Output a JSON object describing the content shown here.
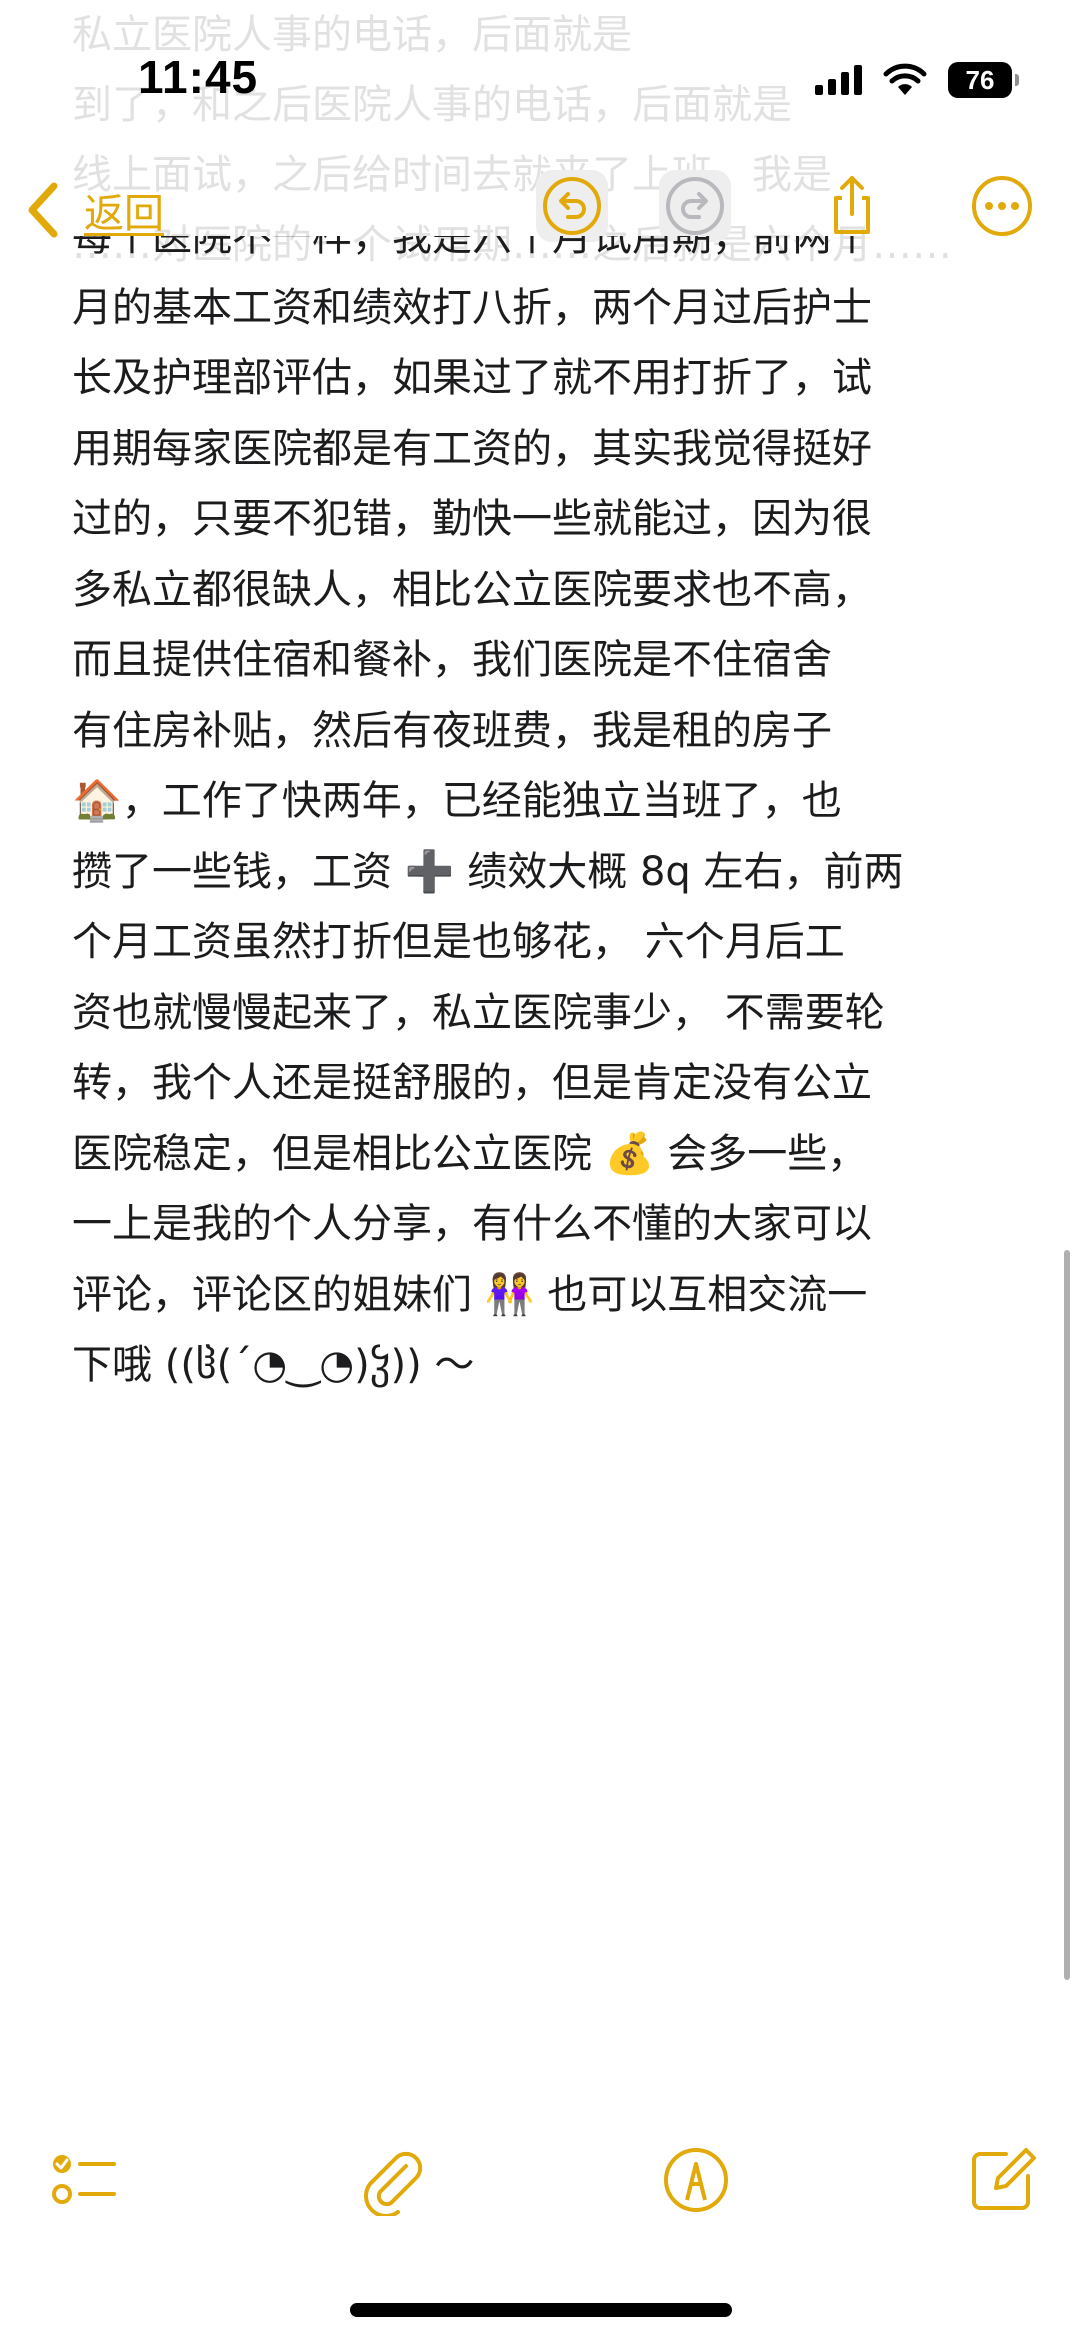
{
  "status_bar": {
    "time": "11:45",
    "battery": "76",
    "icons": [
      "signal-icon",
      "wifi-icon",
      "battery-icon"
    ]
  },
  "ghost_text": {
    "lines": [
      "私立医院人事的电话，后面就是",
      "到了，和之后医院人事的电话，后面就是",
      "线上面试，之后给时间去就来了上班，我是",
      "……对医院的一个试用期……之后就是六个月……"
    ]
  },
  "nav": {
    "back_label": "返回",
    "icons": {
      "back": "chevron-left-icon",
      "undo": "undo-icon",
      "redo": "redo-icon",
      "share": "share-icon",
      "more": "ellipsis-icon"
    },
    "accent_color": "#e2a90b"
  },
  "note": {
    "lines": [
      "每个医院不一样，我是六个月试用期，前两个",
      "月的基本工资和绩效打八折，两个月过后护士",
      "长及护理部评估，如果过了就不用打折了，试",
      "用期每家医院都是有工资的，其实我觉得挺好",
      "过的，只要不犯错，勤快一些就能过，因为很",
      "多私立都很缺人，相比公立医院要求也不高，",
      "而且提供住宿和餐补，我们医院是不住宿舍",
      "有住房补贴，然后有夜班费，我是租的房子",
      "🏠，工作了快两年，已经能独立当班了，也",
      "攒了一些钱，工资 ➕ 绩效大概 8q 左右，前两",
      "个月工资虽然打折但是也够花， 六个月后工",
      "资也就慢慢起来了，私立医院事少， 不需要轮",
      "转，我个人还是挺舒服的，但是肯定没有公立",
      "医院稳定，但是相比公立医院 💰 会多一些，",
      "一上是我的个人分享，有什么不懂的大家可以",
      "评论，评论区的姐妹们 👭 也可以互相交流一",
      "下哦 ((ჱ(´◔‿◔)ჴ)) ～"
    ]
  },
  "toolbar": {
    "icons": {
      "checklist": "checklist-icon",
      "attach": "paperclip-icon",
      "markup": "markup-pen-icon",
      "compose": "compose-icon"
    }
  }
}
